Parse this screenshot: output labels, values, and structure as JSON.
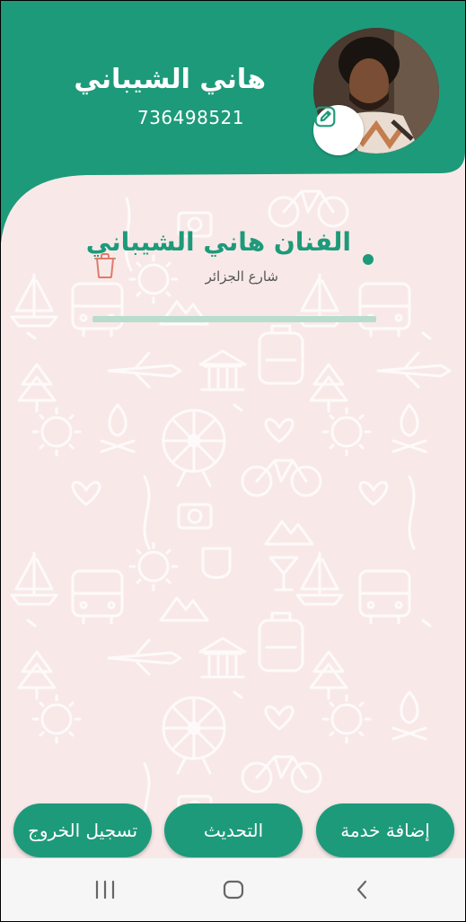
{
  "profile": {
    "name": "هاني الشيباني",
    "phone": "736498521"
  },
  "service": {
    "title": "الفنان هاني الشيباني",
    "subtitle": "شارع الجزائر"
  },
  "buttons": {
    "add_service": "إضافة خدمة",
    "refresh": "التحديث",
    "logout": "تسجيل الخروج"
  },
  "colors": {
    "primary": "#1d9a7a",
    "background": "#f8e9e8",
    "trash": "#e07b6a"
  },
  "icons": {
    "edit": "pencil-icon",
    "delete": "trash-icon",
    "nav_recent": "recent-apps-icon",
    "nav_home": "home-icon",
    "nav_back": "back-icon"
  }
}
